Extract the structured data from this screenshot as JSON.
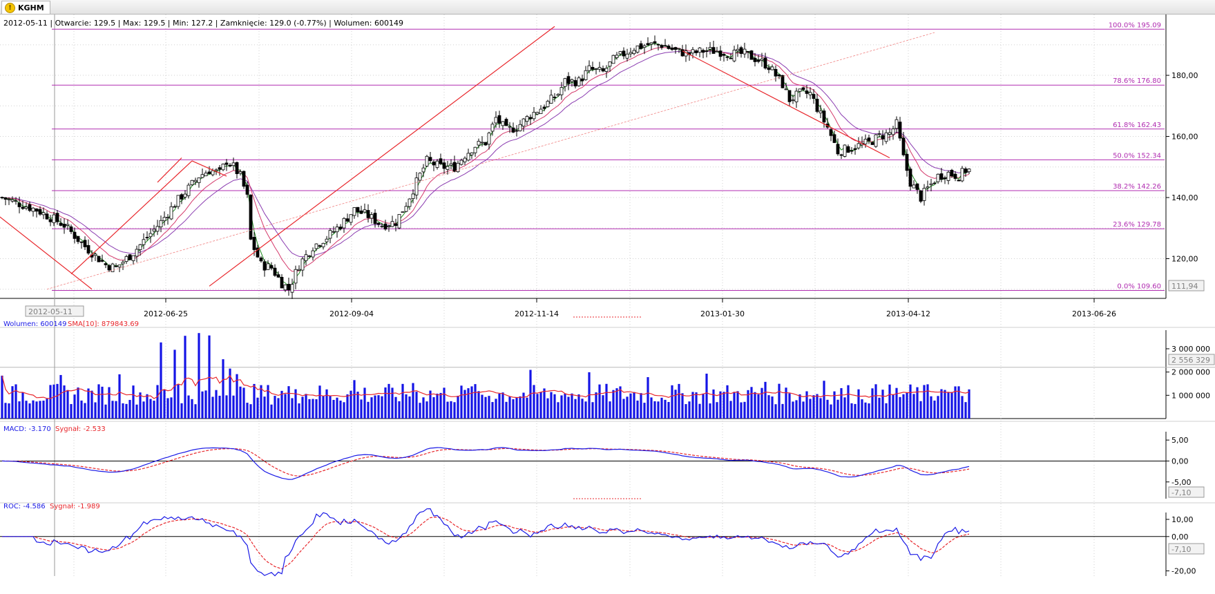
{
  "window": {
    "tab_title": "KGHM",
    "tab_icon": "warning-icon"
  },
  "chart_data": {
    "type": "candlestick",
    "symbol": "KGHM",
    "header": {
      "date": "2012-05-11",
      "open_label": "Otwarcie: 129.5",
      "high_label": "Max: 129.5",
      "low_label": "Min: 127.2",
      "close_label": "Zamknięcie: 129.0 (-0.77%)",
      "volume_label": "Wolumen: 600149",
      "text": "2012-05-11 | Otwarcie: 129.5 | Max: 129.5 | Min: 127.2 | Zamknięcie: 129.0 (-0.77%)  | Wolumen: 600149"
    },
    "x_ticks": [
      "2012-06-25",
      "2012-09-04",
      "2012-11-14",
      "2013-01-30",
      "2013-04-12",
      "2013-06-26"
    ],
    "x_cursor_label": "2012-05-11",
    "price_axis": {
      "ticks": [
        120,
        140,
        160,
        180
      ],
      "tick_labels": [
        "120,00",
        "140,00",
        "160,00",
        "180,00"
      ],
      "range": [
        107,
        199
      ],
      "cursor_label": "111,94"
    },
    "price_path": [
      [
        0,
        140
      ],
      [
        10,
        136
      ],
      [
        18,
        131
      ],
      [
        24,
        124
      ],
      [
        30,
        118
      ],
      [
        33,
        117
      ],
      [
        38,
        122
      ],
      [
        42,
        127
      ],
      [
        46,
        132
      ],
      [
        50,
        138
      ],
      [
        54,
        143
      ],
      [
        57,
        147
      ],
      [
        60,
        149
      ],
      [
        63,
        148
      ],
      [
        65,
        152
      ],
      [
        67,
        150
      ],
      [
        69,
        147
      ],
      [
        71,
        140
      ],
      [
        72,
        126
      ],
      [
        75,
        118
      ],
      [
        78,
        117
      ],
      [
        81,
        112
      ],
      [
        83,
        110
      ],
      [
        86,
        118
      ],
      [
        90,
        124
      ],
      [
        94,
        127
      ],
      [
        98,
        131
      ],
      [
        102,
        136
      ],
      [
        106,
        134
      ],
      [
        110,
        131
      ],
      [
        114,
        132
      ],
      [
        117,
        138
      ],
      [
        120,
        145
      ],
      [
        123,
        152
      ],
      [
        127,
        150
      ],
      [
        131,
        150
      ],
      [
        134,
        154
      ],
      [
        137,
        157
      ],
      [
        140,
        158
      ],
      [
        143,
        166
      ],
      [
        146,
        162
      ],
      [
        149,
        163
      ],
      [
        153,
        167
      ],
      [
        157,
        170
      ],
      [
        161,
        174
      ],
      [
        163,
        178
      ],
      [
        167,
        178
      ],
      [
        170,
        182
      ],
      [
        174,
        181
      ],
      [
        177,
        185
      ],
      [
        180,
        187
      ],
      [
        183,
        189
      ],
      [
        187,
        190
      ],
      [
        191,
        190
      ],
      [
        195,
        188
      ],
      [
        199,
        187
      ],
      [
        203,
        188
      ],
      [
        207,
        188
      ],
      [
        211,
        187
      ],
      [
        215,
        187
      ],
      [
        219,
        185
      ],
      [
        222,
        183
      ],
      [
        226,
        177
      ],
      [
        228,
        172
      ],
      [
        231,
        174
      ],
      [
        234,
        174
      ],
      [
        237,
        167
      ],
      [
        239,
        163
      ],
      [
        242,
        155
      ],
      [
        245,
        156
      ],
      [
        248,
        157
      ],
      [
        251,
        158
      ],
      [
        254,
        160
      ],
      [
        257,
        161
      ],
      [
        259,
        164
      ],
      [
        261,
        153
      ],
      [
        263,
        145
      ],
      [
        266,
        140
      ],
      [
        268,
        143
      ],
      [
        271,
        147
      ],
      [
        274,
        148
      ],
      [
        277,
        147
      ],
      [
        279,
        149
      ],
      [
        280,
        149
      ]
    ],
    "volume_axis": {
      "ticks": [
        1000000,
        2000000,
        3000000
      ],
      "tick_labels": [
        "1 000 000",
        "2 000 000",
        "3 000 000"
      ],
      "range": [
        0,
        3800000
      ],
      "cursor_label": "2 556 329"
    },
    "macd_axis": {
      "ticks": [
        -5,
        0,
        5
      ],
      "tick_labels": [
        "-5,00",
        "0,00",
        "5,00"
      ],
      "range": [
        -9,
        7
      ],
      "cursor_label": "-7,10"
    },
    "roc_axis": {
      "ticks": [
        -20,
        0,
        10
      ],
      "tick_labels": [
        "-20,00",
        "0,00",
        "10,00"
      ],
      "range": [
        -23,
        14
      ],
      "cursor_label": "-7,10"
    },
    "fibonacci": [
      {
        "label": "100.0% 195.09",
        "value": 195.09
      },
      {
        "label": "78.6% 176.80",
        "value": 176.8
      },
      {
        "label": "61.8% 162.43",
        "value": 162.43
      },
      {
        "label": "50.0% 152.34",
        "value": 152.34
      },
      {
        "label": "38.2% 142.26",
        "value": 142.26
      },
      {
        "label": "23.6% 129.78",
        "value": 129.78
      },
      {
        "label": "0.0% 109.60",
        "value": 109.6
      }
    ],
    "volume_legend": {
      "volume": "Wolumen: 600149",
      "sma": "SMA[10]: 879843.69"
    },
    "macd_legend": {
      "macd": "MACD: -3.170",
      "signal": "Sygnał: -2.533"
    },
    "roc_legend": {
      "roc": "ROC: -4.586",
      "signal": "Sygnał: -1.989"
    },
    "colors": {
      "fib": "#b02bb0",
      "trend": "#e8262b",
      "trend_dashed": "#f08080",
      "ma_fast": "#1d8a1d",
      "ma_mid": "#d4386a",
      "ma_slow": "#8a3bb0",
      "volume": "#1414e6",
      "sma": "#e8262b",
      "line_blue": "#1a1ae6",
      "line_red": "#e8262b"
    }
  }
}
